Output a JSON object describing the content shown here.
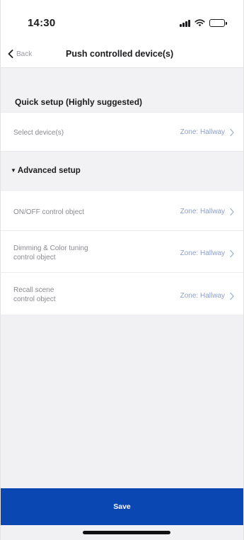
{
  "status_bar": {
    "time": "14:30",
    "icons": [
      "signal-icon",
      "wifi-icon",
      "battery-icon"
    ]
  },
  "nav": {
    "back_label": "Back",
    "title": "Push controlled device(s)"
  },
  "quick_setup": {
    "title": "Quick setup (Highly suggested)",
    "select_devices": {
      "label": "Select device(s)",
      "value": "Zone: Hallway"
    }
  },
  "advanced_setup": {
    "title": "Advanced setup",
    "rows": [
      {
        "label": "ON/OFF control object",
        "value": "Zone: Hallway"
      },
      {
        "label_line1": "Dimming & Color tuning",
        "label_line2": "control object",
        "value": "Zone: Hallway"
      },
      {
        "label_line1": "Recall scene",
        "label_line2": "control object",
        "value": "Zone: Hallway"
      }
    ]
  },
  "footer": {
    "save_label": "Save"
  },
  "colors": {
    "accent": "#0b47b3",
    "value_text": "#8ea0c6",
    "background": "#f1f1f3"
  }
}
